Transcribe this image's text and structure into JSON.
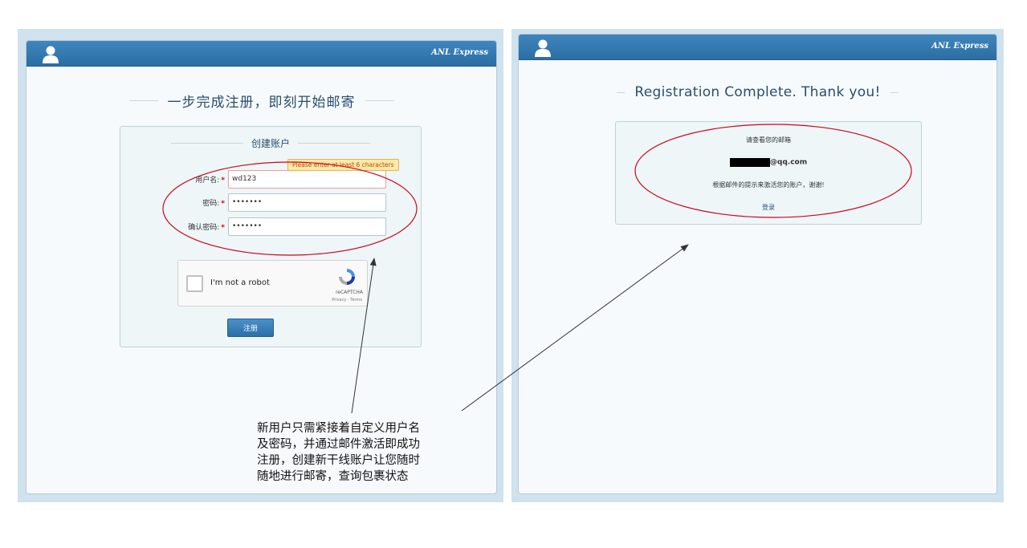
{
  "left_panel": {
    "brand": "ANL Express",
    "page_title": "一步完成注册，即刻开始邮寄",
    "form": {
      "title": "创建账户",
      "fields": [
        {
          "label": "用户名:",
          "value": "wd123",
          "type": "text"
        },
        {
          "label": "密码:",
          "value": "•••••••",
          "type": "password"
        },
        {
          "label": "确认密码:",
          "value": "•••••••",
          "type": "password"
        }
      ],
      "required_mark": "*",
      "error_tooltip": "Please enter at least 6 characters",
      "captcha": {
        "label": "I'm not a robot",
        "brand": "reCAPTCHA",
        "links": "Privacy - Terms"
      },
      "submit_label": "注册"
    }
  },
  "right_panel": {
    "brand": "ANL Express",
    "page_title": "Registration Complete. Thank you!",
    "check_email": "请查看您的邮箱",
    "email_domain": "@qq.com",
    "activate_message": "根据邮件的提示来激活您的账户，谢谢!",
    "login_label": "登录"
  },
  "caption": {
    "lines": [
      "新用户只需紧接着自定义用户名",
      "及密码，并通过邮件激活即成功",
      "注册，创建新干线账户让您随时",
      "随地进行邮寄，查询包裹状态"
    ]
  },
  "colors": {
    "header": "#2f75ab",
    "annotation_ellipse": "#d0021b",
    "error_tooltip_bg": "#fde9a8"
  }
}
